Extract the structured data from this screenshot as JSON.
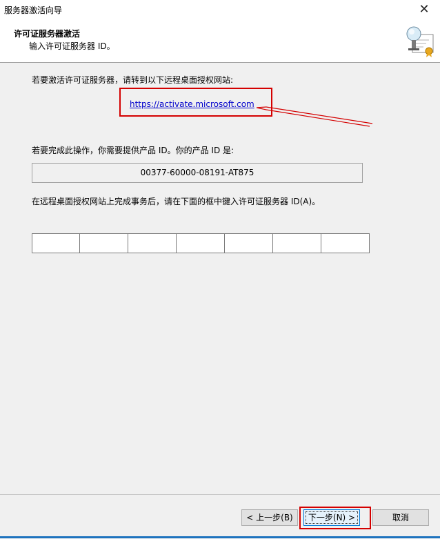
{
  "window": {
    "title": "服务器激活向导",
    "close_glyph": "✕"
  },
  "header": {
    "title": "许可证服务器激活",
    "subtitle": "输入许可证服务器 ID。",
    "icon": "certificate-icon"
  },
  "main": {
    "instruction_1": "若要激活许可证服务器，请转到以下远程桌面授权网站:",
    "activation_link": "https://activate.microsoft.com",
    "instruction_2": "若要完成此操作，你需要提供产品 ID。你的产品 ID 是:",
    "product_id": "00377-60000-08191-AT875",
    "instruction_3": "在远程桌面授权网站上完成事务后，请在下面的框中键入许可证服务器 ID(A)。",
    "license_id_fields": [
      "",
      "",
      "",
      "",
      "",
      "",
      ""
    ]
  },
  "footer": {
    "back_label": "< 上一步(B)",
    "next_label": "下一步(N) >",
    "cancel_label": "取消"
  },
  "colors": {
    "annotation_red": "#d40000",
    "link_blue": "#0000cc",
    "focus_blue": "#0078d7"
  }
}
